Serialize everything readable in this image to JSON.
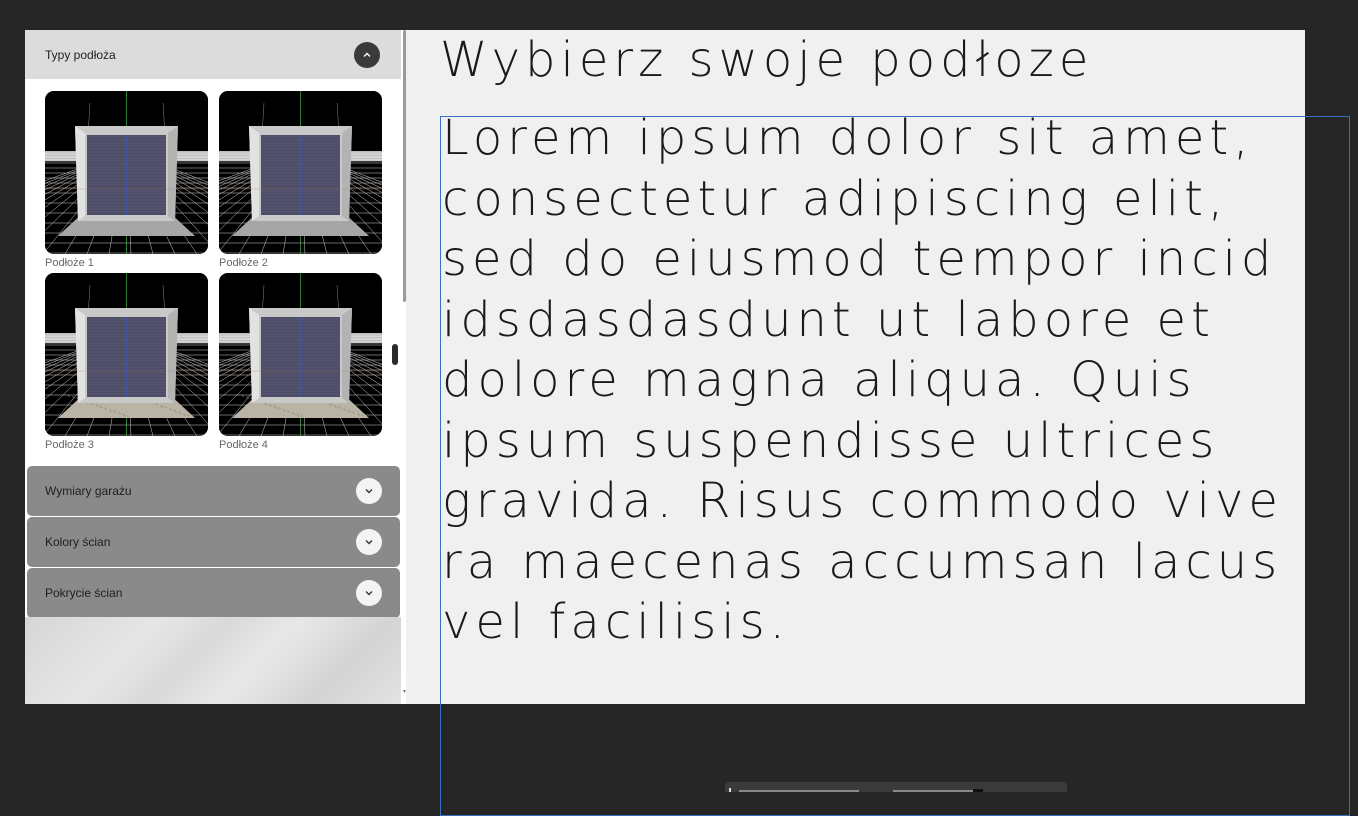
{
  "sidebar": {
    "open_section": {
      "title": "Typy podłoża",
      "toggle_icon": "chevron-up-icon",
      "items": [
        {
          "label": "Podłoże 1",
          "floor": "dark-grid"
        },
        {
          "label": "Podłoże 2",
          "floor": "dark-grid"
        },
        {
          "label": "Podłoże 3",
          "floor": "gravel"
        },
        {
          "label": "Podłoże 4",
          "floor": "gravel"
        }
      ]
    },
    "collapsed_sections": [
      {
        "title": "Wymiary garażu",
        "toggle_icon": "chevron-down-icon"
      },
      {
        "title": "Kolory ścian",
        "toggle_icon": "chevron-down-icon"
      },
      {
        "title": "Pokrycie ścian",
        "toggle_icon": "chevron-down-icon"
      }
    ]
  },
  "main": {
    "title": "Wybierz swoje podłoze",
    "body_lines": [
      "Lorem ipsum dolor sit amet,",
      "consectetur adipiscing elit,",
      "sed do eiusmod tempor incid",
      "idsdasdasdunt ut labore et",
      "dolore magna aliqua. Quis",
      "ipsum suspendisse ultrices",
      "gravida. Risus commodo vive",
      "ra maecenas accumsan lacus",
      "vel facilisis."
    ]
  },
  "colors": {
    "background": "#262626",
    "panel": "#f0f0f0",
    "collapsed_header": "#8a8a8a",
    "open_header": "#dcdcdc",
    "selection_outline": "#3b6fc2"
  }
}
